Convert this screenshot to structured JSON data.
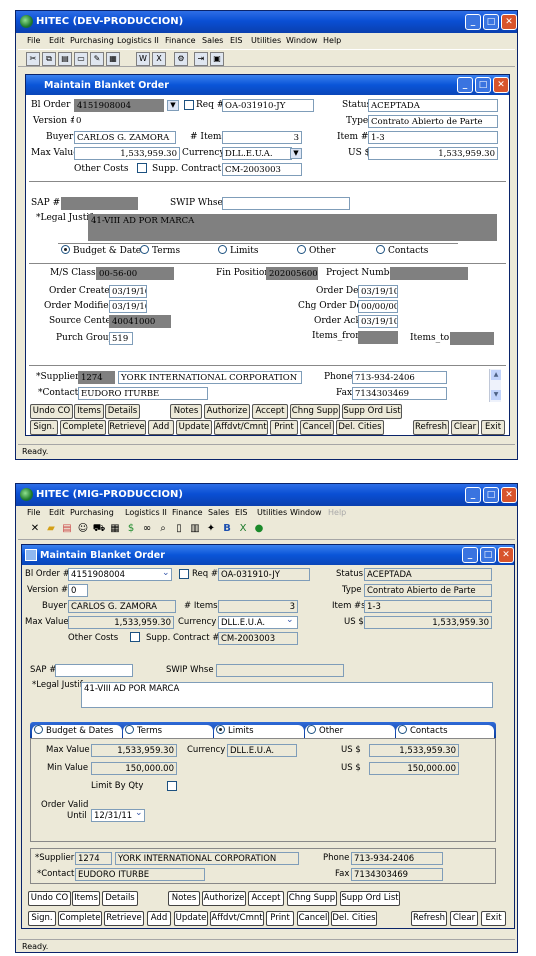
{
  "w1": {
    "app_title": "HITEC  (DEV-PRODUCCION)",
    "menu": [
      "File",
      "Edit",
      "Purchasing",
      "Logistics II",
      "Finance",
      "Sales",
      "EIS",
      "Utilities",
      "Window",
      "Help"
    ],
    "form_title": "Maintain Blanket Order",
    "bl_order_label": "Bl Order #",
    "bl_order": "4151908004",
    "req_label": "Req #",
    "req": "OA-031910-JY",
    "status_label": "Status",
    "status": "ACEPTADA",
    "version_label": "Version #",
    "version": "0",
    "type_label": "Type",
    "type": "Contrato Abierto de Parte",
    "buyer_label": "Buyer",
    "buyer": "CARLOS G.  ZAMORA",
    "items_label": "# Items",
    "items": "3",
    "itemno_label": "Item #s",
    "itemno": "1-3",
    "maxval_label": "Max Value",
    "maxval": "1,533,959.30",
    "currency_label": "Currency",
    "currency": "DLL.E.U.A.",
    "us_label": "US $",
    "us": "1,533,959.30",
    "other_costs_label": "Other Costs",
    "supp_contract_label": "Supp. Contract #",
    "supp_contract": "CM-2003003",
    "sap_label": "SAP #",
    "swip_label": "SWIP Whse",
    "legal_label": "*Legal Justif",
    "legal": "41-VIII AD POR MARCA",
    "radios": [
      "Budget & Dates",
      "Terms",
      "Limits",
      "Other",
      "Contacts"
    ],
    "ms_class_label": "M/S Class",
    "ms_class": "00-56-00",
    "fin_pos_label": "Fin Position",
    "fin_pos": "202005600",
    "project_label": "Project Number",
    "order_created_label": "Order Created",
    "order_created": "03/19/10",
    "order_del_label": "Order Del",
    "order_del": "03/19/10",
    "order_mod_label": "Order Modified",
    "order_mod": "03/19/10",
    "chg_order_label": "Chg Order Del",
    "chg_order": "00/00/00",
    "source_label": "Source Center",
    "source": "40041000",
    "order_ack_label": "Order Ack",
    "order_ack": "03/19/10",
    "purch_group_label": "Purch Group",
    "purch_group": "519",
    "items_from_label": "Items_from",
    "items_to_label": "Items_to",
    "supplier_label": "*Supplier",
    "supplier_code": "1274",
    "supplier_name": "YORK INTERNATIONAL CORPORATION",
    "phone_label": "Phone",
    "phone": "713-934-2406",
    "contact_label": "*Contact",
    "contact": "EUDORO  ITURBE",
    "fax_label": "Fax",
    "fax": "7134303469",
    "buttons1": [
      "Undo CO",
      "Items",
      "Details",
      "Notes",
      "Authorize",
      "Accept",
      "Chng Supp",
      "Supp Ord List"
    ],
    "buttons2": [
      "Sign.",
      "Complete",
      "Retrieve",
      "Add",
      "Update",
      "Affdvt/Cmnt",
      "Print",
      "Cancel",
      "Del. Cities",
      "Refresh",
      "Clear",
      "Exit"
    ],
    "statusbar": "Ready."
  },
  "w2": {
    "app_title": "HITEC  (MIG-PRODUCCION)",
    "menu": [
      "File",
      "Edit",
      "Purchasing",
      "Logistics II",
      "Finance",
      "Sales",
      "EIS",
      "Utilities",
      "Window",
      "Help"
    ],
    "form_title": "Maintain Blanket Order",
    "bl_order_label": "Bl Order #",
    "bl_order": "4151908004",
    "req_label": "Req #",
    "req": "OA-031910-JY",
    "status_label": "Status",
    "status": "ACEPTADA",
    "version_label": "Version #",
    "version": "0",
    "type_label": "Type",
    "type": "Contrato Abierto de Parte",
    "buyer_label": "Buyer",
    "buyer": "CARLOS G.  ZAMORA",
    "items_label": "# Items",
    "items": "3",
    "itemno_label": "Item #s",
    "itemno": "1-3",
    "maxval_label": "Max Value",
    "maxval": "1,533,959.30",
    "currency_label": "Currency",
    "currency": "DLL.E.U.A.",
    "us_label": "US $",
    "us": "1,533,959.30",
    "other_costs_label": "Other Costs",
    "supp_contract_label": "Supp. Contract #",
    "supp_contract": "CM-2003003",
    "sap_label": "SAP #",
    "swip_label": "SWIP Whse",
    "legal_label": "*Legal Justif",
    "legal": "41-VIII AD POR MARCA",
    "tabs": [
      "Budget & Dates",
      "Terms",
      "Limits",
      "Other",
      "Contacts"
    ],
    "max_value_label": "Max Value",
    "max_value": "1,533,959.30",
    "lim_currency_label": "Currency",
    "lim_currency": "DLL.E.U.A.",
    "us1_label": "US $",
    "us1": "1,533,959.30",
    "min_value_label": "Min Value",
    "min_value": "150,000.00",
    "us2_label": "US $",
    "us2": "150,000.00",
    "limit_qty_label": "Limit By Qty",
    "order_valid_label": "Order Valid",
    "until_label": "Until",
    "until": "12/31/11",
    "supplier_label": "*Supplier",
    "supplier_code": "1274",
    "supplier_name": "YORK INTERNATIONAL CORPORATION",
    "phone_label": "Phone",
    "phone": "713-934-2406",
    "contact_label": "*Contact",
    "contact": "EUDORO  ITURBE",
    "fax_label": "Fax",
    "fax": "7134303469",
    "buttons1": [
      "Undo CO",
      "Items",
      "Details",
      "Notes",
      "Authorize",
      "Accept",
      "Chng Supp",
      "Supp Ord List"
    ],
    "buttons2": [
      "Sign.",
      "Complete",
      "Retrieve",
      "Add",
      "Update",
      "Affdvt/Cmnt",
      "Print",
      "Cancel",
      "Del. Cities",
      "Refresh",
      "Clear",
      "Exit"
    ],
    "statusbar": "Ready."
  },
  "colors": {
    "titlebar": "#0a4fd4",
    "field_gray": "#808080",
    "tab_bar": "#0a3d9e",
    "frame": "#ece9d8"
  }
}
